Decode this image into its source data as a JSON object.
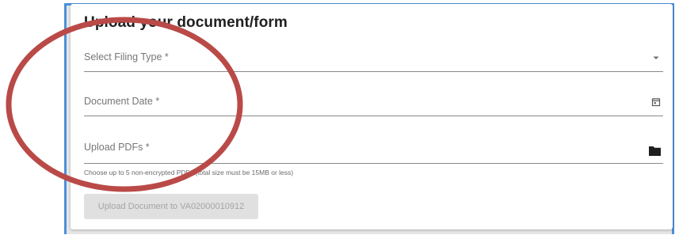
{
  "form": {
    "title": "Upload your document/form",
    "filing_type_label": "Select Filing Type *",
    "document_date_label": "Document Date *",
    "upload_label": "Upload PDFs *",
    "upload_helper": "Choose up to 5 non-encrypted PDFs (total size must be 15MB or less)",
    "submit_label": "Upload Document to VA02000010912"
  },
  "icons": {
    "filing_type": "dropdown-arrow-icon",
    "document_date": "calendar-icon",
    "upload": "folder-icon"
  },
  "colors": {
    "frame_border": "#4a90d9",
    "annotation_circle": "#b94a48",
    "disabled_button_bg": "#e0e0e0",
    "disabled_button_text": "#a4a4a4"
  },
  "state": {
    "submit_enabled": false
  }
}
